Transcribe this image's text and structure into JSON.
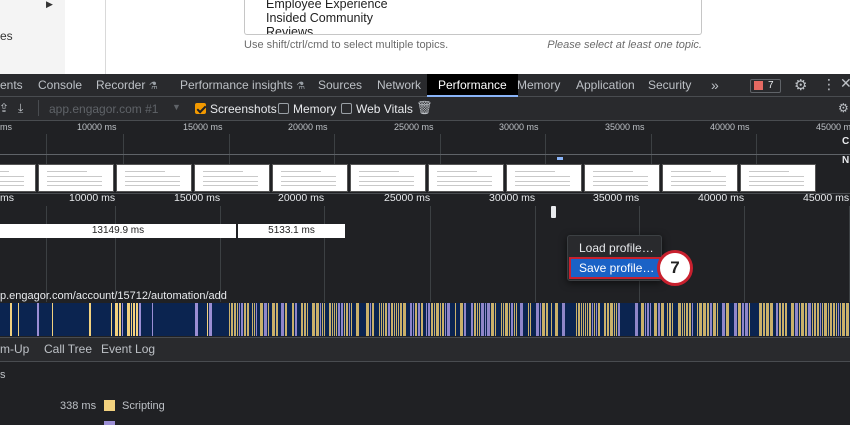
{
  "page": {
    "left_nav_text": "es",
    "topics": [
      "Employee Experience",
      "Insided Community",
      "Reviews"
    ],
    "topics_hint": "Use shift/ctrl/cmd to select multiple topics.",
    "topics_error": "Please select at least one topic."
  },
  "devtools": {
    "tabs": [
      "ents",
      "Console",
      "Recorder",
      "Performance insights",
      "Sources",
      "Network",
      "Performance",
      "Memory",
      "Application",
      "Security"
    ],
    "active_tab": "Performance",
    "issues_count": "7",
    "toolbar": {
      "target": "app.engagor.com #1",
      "screenshots_label": "Screenshots",
      "memory_label": "Memory",
      "web_vitals_label": "Web Vitals"
    },
    "overview_ticks": [
      "ms",
      "10000 ms",
      "15000 ms",
      "20000 ms",
      "25000 ms",
      "30000 ms",
      "35000 ms",
      "40000 ms",
      "45000 ms"
    ],
    "main_ticks": [
      "ms",
      "10000 ms",
      "15000 ms",
      "20000 ms",
      "25000 ms",
      "30000 ms",
      "35000 ms",
      "40000 ms",
      "45000 ms"
    ],
    "bars": [
      "13149.9 ms",
      "5133.1 ms"
    ],
    "url_label": "p.engagor.com/account/15712/automation/add",
    "bottom_tabs": [
      "m-Up",
      "Call Tree",
      "Event Log"
    ],
    "summary_head": "s",
    "summary_rows": [
      {
        "value": "338 ms",
        "label": "Scripting",
        "color": "#f2d17e"
      },
      {
        "value": "",
        "label": "",
        "color": "#9b8ed4"
      }
    ]
  },
  "context_menu": {
    "items": [
      "Load profile…",
      "Save profile…"
    ],
    "highlighted_index": 1
  },
  "step_marker": "7",
  "colors": {
    "accent_blue": "#8ab4f8",
    "menu_highlight": "#1a62c6",
    "callout_red": "#c8202e",
    "checkbox_orange": "#f29900"
  }
}
